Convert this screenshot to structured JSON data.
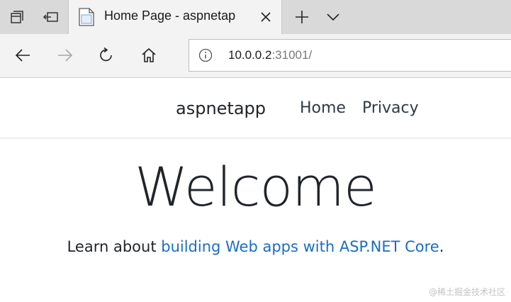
{
  "browser": {
    "tab": {
      "title": "Home Page - aspnetap"
    },
    "address": {
      "host": "10.0.0.2",
      "port": ":31001/"
    }
  },
  "site": {
    "brand": "aspnetapp",
    "nav": [
      {
        "label": "Home"
      },
      {
        "label": "Privacy"
      }
    ]
  },
  "content": {
    "heading": "Welcome",
    "lead_prefix": "Learn about ",
    "lead_link": "building Web apps with ASP.NET Core",
    "lead_suffix": "."
  },
  "watermark": "@稀土掘金技术社区",
  "colors": {
    "link": "#1b6ec2",
    "tab_strip": "#d9d9d9",
    "toolbar": "#f3f3f3"
  },
  "icons": [
    "tab-aside-icon",
    "back-tabs-icon",
    "page-favicon",
    "close-icon",
    "plus-icon",
    "chevron-down-icon",
    "back-arrow-icon",
    "forward-arrow-icon",
    "refresh-icon",
    "home-icon",
    "info-icon"
  ]
}
